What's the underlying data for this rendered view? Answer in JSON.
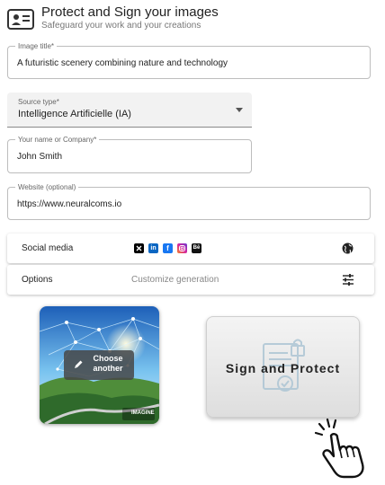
{
  "header": {
    "title": "Protect and Sign your images",
    "subtitle": "Safeguard your work and your creations"
  },
  "form": {
    "image_title": {
      "label": "Image title*",
      "value": "A futuristic scenery combining nature and technology"
    },
    "source_type": {
      "label": "Source type*",
      "value": "Intelligence Artificielle (IA)"
    },
    "name": {
      "label": "Your name or Company*",
      "value": "John Smith"
    },
    "website": {
      "label": "Website (optional)",
      "value": "https://www.neuralcoms.io"
    }
  },
  "social": {
    "label": "Social media",
    "icons": [
      "x-icon",
      "linkedin-icon",
      "facebook-icon",
      "instagram-icon",
      "behance-icon"
    ],
    "behance_text": "Bē"
  },
  "options": {
    "label": "Options",
    "subtitle": "Customize generation"
  },
  "image": {
    "choose_label": "Choose another",
    "brand": "IMAGINE"
  },
  "sign_button": {
    "label": "Sign and Protect"
  },
  "colors": {
    "linkedin": "#0a66c2",
    "facebook": "#1877f2",
    "instagram": "#d6249f",
    "x": "#000000",
    "behance": "#111111"
  }
}
